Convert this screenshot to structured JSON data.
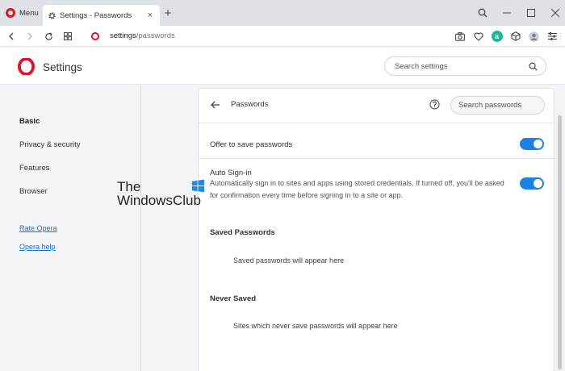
{
  "browser": {
    "menu_label": "Menu",
    "tab_title": "Settings - Passwords",
    "tab_close": "×",
    "new_tab": "+",
    "url_host": "settings",
    "url_path": "/passwords",
    "brand_color": "#d9152a",
    "account_initial": "a"
  },
  "header": {
    "title": "Settings",
    "search_placeholder": "Search settings"
  },
  "sidebar": {
    "items": [
      {
        "label": "Basic",
        "active": true
      },
      {
        "label": "Privacy & security",
        "active": false
      },
      {
        "label": "Features",
        "active": false
      },
      {
        "label": "Browser",
        "active": false
      }
    ],
    "links": [
      "Rate Opera",
      "Opera help"
    ]
  },
  "watermark": {
    "line1": "The",
    "line2": "WindowsClub"
  },
  "panel": {
    "title": "Passwords",
    "search_placeholder": "Search passwords",
    "offer_label": "Offer to save passwords",
    "offer_enabled": true,
    "autosignin_label": "Auto Sign-in",
    "autosignin_desc": "Automatically sign in to sites and apps using stored credentials. If turned off, you'll be asked for confirmation every time before signing in to a site or app.",
    "autosignin_enabled": true,
    "saved_title": "Saved Passwords",
    "saved_empty": "Saved passwords will appear here",
    "never_title": "Never Saved",
    "never_empty": "Sites which never save passwords will appear here",
    "toggle_color": "#1a82e2"
  }
}
